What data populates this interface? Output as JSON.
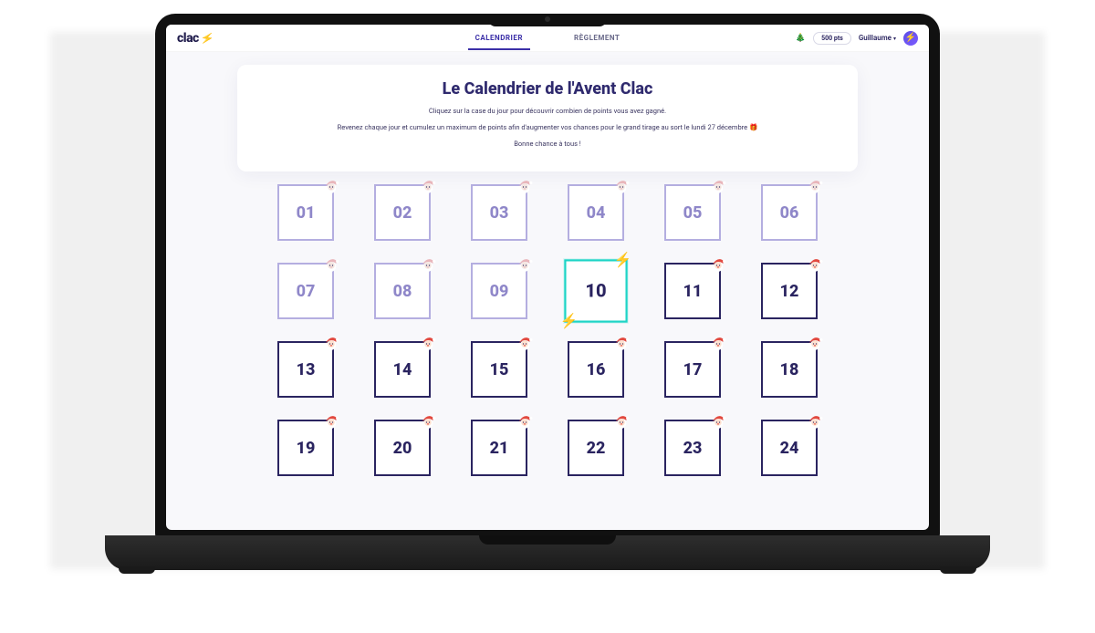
{
  "brand": {
    "name": "clac"
  },
  "nav": {
    "calendar": "CALENDRIER",
    "rules": "RÈGLEMENT"
  },
  "user": {
    "points_label": "500 pts",
    "name": "Guillaume"
  },
  "hero": {
    "title": "Le Calendrier de l'Avent Clac",
    "line1": "Cliquez sur la case du jour pour découvrir combien de points vous avez gagné.",
    "line2": "Revenez chaque jour et cumulez un maximum de points afin d'augmenter vos chances pour le grand tirage au sort le lundi 27 décembre",
    "gift_emoji": "🎁",
    "line3": "Bonne chance à tous !"
  },
  "days": [
    {
      "n": "01",
      "state": "opened"
    },
    {
      "n": "02",
      "state": "opened"
    },
    {
      "n": "03",
      "state": "opened"
    },
    {
      "n": "04",
      "state": "opened"
    },
    {
      "n": "05",
      "state": "opened"
    },
    {
      "n": "06",
      "state": "opened"
    },
    {
      "n": "07",
      "state": "opened"
    },
    {
      "n": "08",
      "state": "opened"
    },
    {
      "n": "09",
      "state": "opened"
    },
    {
      "n": "10",
      "state": "today"
    },
    {
      "n": "11",
      "state": "locked"
    },
    {
      "n": "12",
      "state": "locked"
    },
    {
      "n": "13",
      "state": "locked"
    },
    {
      "n": "14",
      "state": "locked"
    },
    {
      "n": "15",
      "state": "locked"
    },
    {
      "n": "16",
      "state": "locked"
    },
    {
      "n": "17",
      "state": "locked"
    },
    {
      "n": "18",
      "state": "locked"
    },
    {
      "n": "19",
      "state": "locked"
    },
    {
      "n": "20",
      "state": "locked"
    },
    {
      "n": "21",
      "state": "locked"
    },
    {
      "n": "22",
      "state": "locked"
    },
    {
      "n": "23",
      "state": "locked"
    },
    {
      "n": "24",
      "state": "locked"
    }
  ]
}
